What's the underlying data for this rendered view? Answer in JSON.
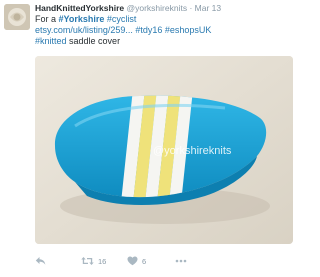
{
  "tweet": {
    "display_name": "HandKnittedYorkshire",
    "handle": "@yorkshireknits",
    "separator": "·",
    "timestamp": "Mar 13",
    "text": {
      "for_prefix": "For a ",
      "tag_yorkshire": "#Yorkshire",
      "tag_cyclist": " #cyclist",
      "link": "etsy.com/uk/listing/259...",
      "tag_tdy16": " #tdy16",
      "tag_eshopsuk": " #eshopsUK",
      "tag_knitted": "#knitted",
      "suffix": " saddle cover"
    },
    "media": {
      "watermark": "@yorkshireknits"
    },
    "actions": {
      "retweet_count": "16",
      "like_count": "6"
    }
  },
  "colors": {
    "link": "#2a7ab0",
    "muted": "#8899a6",
    "icon": "#aab8c2",
    "saddle_blue": "#17a3d6",
    "stripe_yellow": "#efe27a"
  },
  "icons": {
    "reply": "reply-icon",
    "retweet": "retweet-icon",
    "like": "heart-icon",
    "more": "more-icon"
  }
}
